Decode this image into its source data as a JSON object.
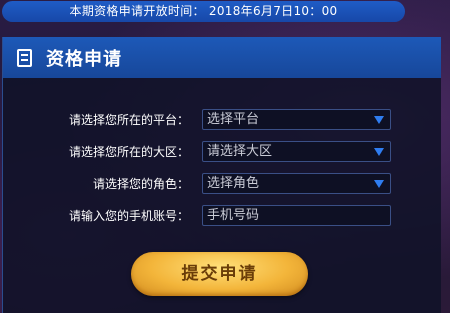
{
  "banner": {
    "text": "本期资格申请开放时间： 2018年6月7日10：00"
  },
  "panel": {
    "title": "资格申请",
    "header_icon": "document-list-icon"
  },
  "form": {
    "platform": {
      "label": "请选择您所在的平台：",
      "value": "选择平台"
    },
    "region": {
      "label": "请选择您所在的大区：",
      "value": "请选择大区"
    },
    "role": {
      "label": "请选择您的角色：",
      "value": "选择角色"
    },
    "phone": {
      "label": "请输入您的手机账号：",
      "placeholder": "手机号码"
    },
    "submit_label": "提交申请"
  },
  "colors": {
    "banner_blue": "#1f5cc6",
    "header_blue": "#1d59b8",
    "arrow_blue": "#2f7df0",
    "button_gold": "#f3b53a"
  }
}
